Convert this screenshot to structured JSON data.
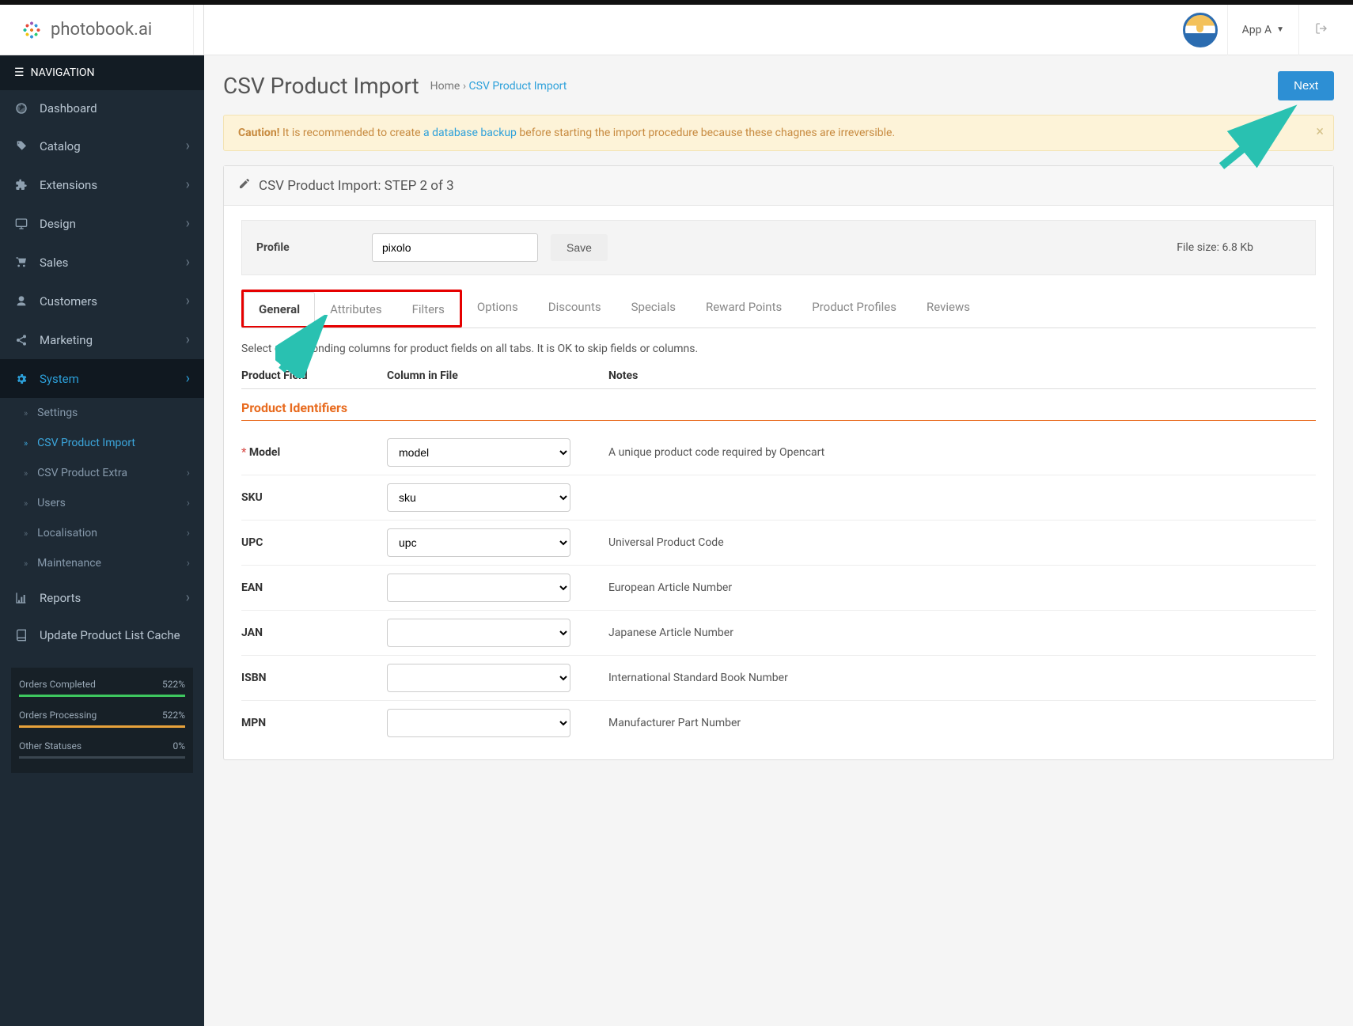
{
  "brand": "photobook.ai",
  "header": {
    "app_menu": "App A"
  },
  "nav": {
    "title": "NAVIGATION",
    "items": [
      {
        "icon": "dashboard",
        "label": "Dashboard",
        "sub": false
      },
      {
        "icon": "tag",
        "label": "Catalog",
        "sub": true
      },
      {
        "icon": "puzzle",
        "label": "Extensions",
        "sub": true
      },
      {
        "icon": "monitor",
        "label": "Design",
        "sub": true
      },
      {
        "icon": "cart",
        "label": "Sales",
        "sub": true
      },
      {
        "icon": "user",
        "label": "Customers",
        "sub": true
      },
      {
        "icon": "share",
        "label": "Marketing",
        "sub": true
      },
      {
        "icon": "gear",
        "label": "System",
        "sub": true,
        "active": true
      },
      {
        "icon": "chart",
        "label": "Reports",
        "sub": true
      },
      {
        "icon": "book",
        "label": "Update Product List Cache",
        "sub": false
      }
    ],
    "system_sub": [
      {
        "label": "Settings"
      },
      {
        "label": "CSV Product Import",
        "active": true
      },
      {
        "label": "CSV Product Extra",
        "sub": true
      },
      {
        "label": "Users",
        "sub": true
      },
      {
        "label": "Localisation",
        "sub": true
      },
      {
        "label": "Maintenance",
        "sub": true
      }
    ]
  },
  "stats": [
    {
      "label": "Orders Completed",
      "value": "522%",
      "color": "green"
    },
    {
      "label": "Orders Processing",
      "value": "522%",
      "color": "orange"
    },
    {
      "label": "Other Statuses",
      "value": "0%",
      "color": "grey"
    }
  ],
  "page": {
    "title": "CSV Product Import",
    "crumb_home": "Home",
    "crumb_sep": " › ",
    "crumb_current": "CSV Product Import",
    "next": "Next"
  },
  "alert": {
    "bold": "Caution!",
    "t1": " It is recommended to create ",
    "link": "a database backup",
    "t2": " before starting the import procedure because these chagnes are irreversible."
  },
  "panel": {
    "title": "CSV Product Import: STEP 2 of 3",
    "profile_label": "Profile",
    "profile_value": "pixolo",
    "save": "Save",
    "file_size": "File size: 6.8 Kb"
  },
  "tabs": [
    "General",
    "Attributes",
    "Filters",
    "Options",
    "Discounts",
    "Specials",
    "Reward Points",
    "Product Profiles",
    "Reviews"
  ],
  "instruction": "Select corresponding columns for product fields on all tabs. It is OK to skip fields or columns.",
  "cols": {
    "field": "Product Field",
    "column": "Column in File",
    "notes": "Notes"
  },
  "section": "Product Identifiers",
  "fields": [
    {
      "label": "Model",
      "required": true,
      "value": "model",
      "note": "A unique product code required by Opencart"
    },
    {
      "label": "SKU",
      "value": "sku",
      "note": ""
    },
    {
      "label": "UPC",
      "value": "upc",
      "note": "Universal Product Code"
    },
    {
      "label": "EAN",
      "value": "",
      "note": "European Article Number"
    },
    {
      "label": "JAN",
      "value": "",
      "note": "Japanese Article Number"
    },
    {
      "label": "ISBN",
      "value": "",
      "note": "International Standard Book Number"
    },
    {
      "label": "MPN",
      "value": "",
      "note": "Manufacturer Part Number"
    }
  ]
}
